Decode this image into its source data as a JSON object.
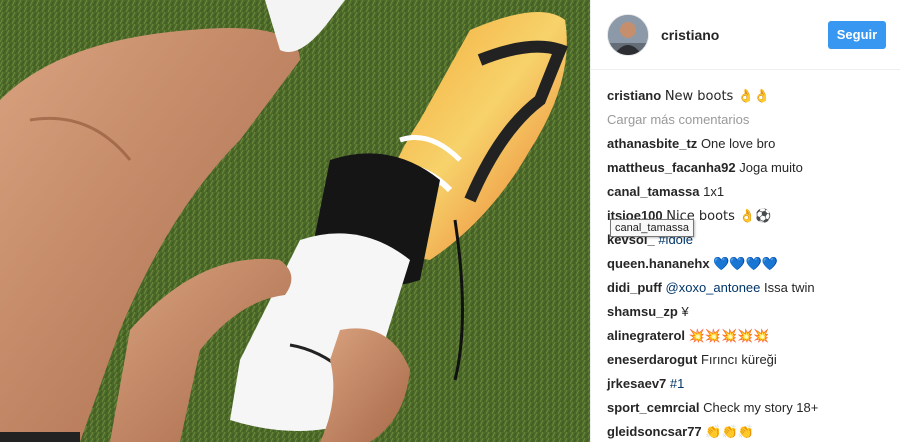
{
  "post": {
    "photo_alt": "Photo of player lacing boots",
    "header": {
      "username": "cristiano",
      "follow_label": "Seguir"
    },
    "caption": {
      "username": "cristiano",
      "text": "New boots 👌👌"
    },
    "load_more_label": "Cargar más comentarios",
    "comments": [
      {
        "username": "athanasbite_tz",
        "text": "One love bro",
        "link": ""
      },
      {
        "username": "mattheus_facanha92",
        "text": "Joga muito",
        "link": ""
      },
      {
        "username": "canal_tamassa",
        "text": "1x1",
        "link": ""
      },
      {
        "username": "itsjoe100",
        "text": "Nice boots 👌⚽",
        "link": ""
      },
      {
        "username": "kevsol_",
        "text": "",
        "link": "#idole"
      },
      {
        "username": "queen.hananehx",
        "text": "💙💙💙💙",
        "link": ""
      },
      {
        "username": "didi_puff",
        "text": "Issa twin",
        "link": "@xoxo_antonee"
      },
      {
        "username": "shamsu_zp",
        "text": "¥",
        "link": ""
      },
      {
        "username": "alinegraterol",
        "text": "💥💥💥💥💥",
        "link": ""
      },
      {
        "username": "eneserdarogut",
        "text": "Fırıncı küreği",
        "link": ""
      },
      {
        "username": "jrkesaev7",
        "text": "",
        "link": "#1"
      },
      {
        "username": "sport_cemrcial",
        "text": "Check my story 18+",
        "link": ""
      },
      {
        "username": "gleidsoncsar77",
        "text": "👏👏👏",
        "link": ""
      }
    ],
    "tooltip": "canal_tamassa"
  }
}
